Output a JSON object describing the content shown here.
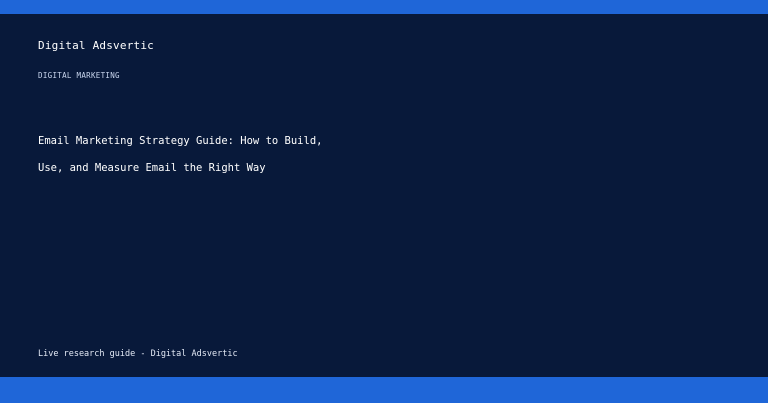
{
  "colors": {
    "background": "#08193a",
    "accent_bar": "#1f66d8",
    "text": "#ffffff"
  },
  "brand": {
    "name": "Digital Adsvertic"
  },
  "article": {
    "category": "DIGITAL MARKETING",
    "title_lines": [
      "Email Marketing Strategy Guide: How to Build,",
      "Use, and Measure Email the Right Way"
    ]
  },
  "footer": {
    "text": "Live research guide - Digital Adsvertic"
  }
}
